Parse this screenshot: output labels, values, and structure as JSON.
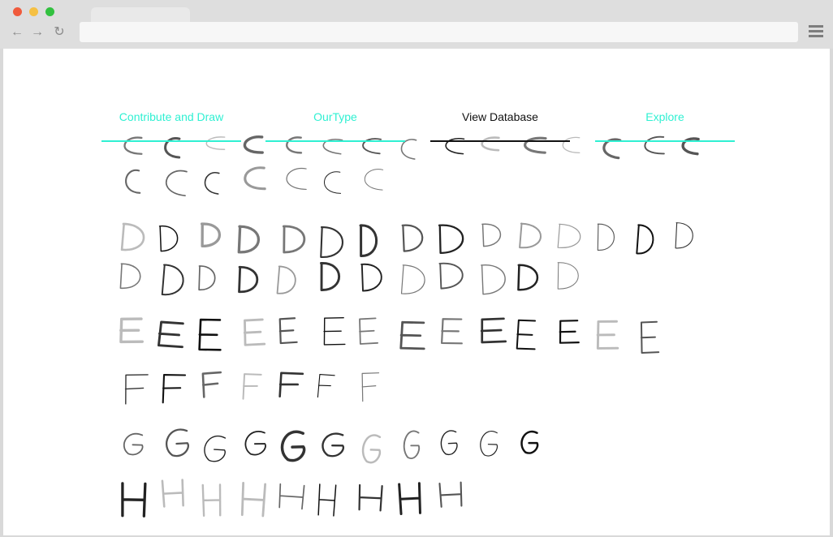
{
  "nav": {
    "items": [
      {
        "label": "Contribute and Draw",
        "active": false
      },
      {
        "label": "OurType",
        "active": false
      },
      {
        "label": "View Database",
        "active": true
      },
      {
        "label": "Explore",
        "active": false
      }
    ]
  },
  "colors": {
    "accent": "#2ff0d2",
    "active": "#111111"
  },
  "glyph_rows": [
    {
      "letter": "C",
      "count": 15,
      "partial": true
    },
    {
      "letter": "C",
      "count": 7
    },
    {
      "letter": "D",
      "count": 15
    },
    {
      "letter": "D",
      "count": 12
    },
    {
      "letter": "E",
      "count": 14
    },
    {
      "letter": "F",
      "count": 7
    },
    {
      "letter": "G",
      "count": 11
    },
    {
      "letter": "H",
      "count": 9
    }
  ]
}
